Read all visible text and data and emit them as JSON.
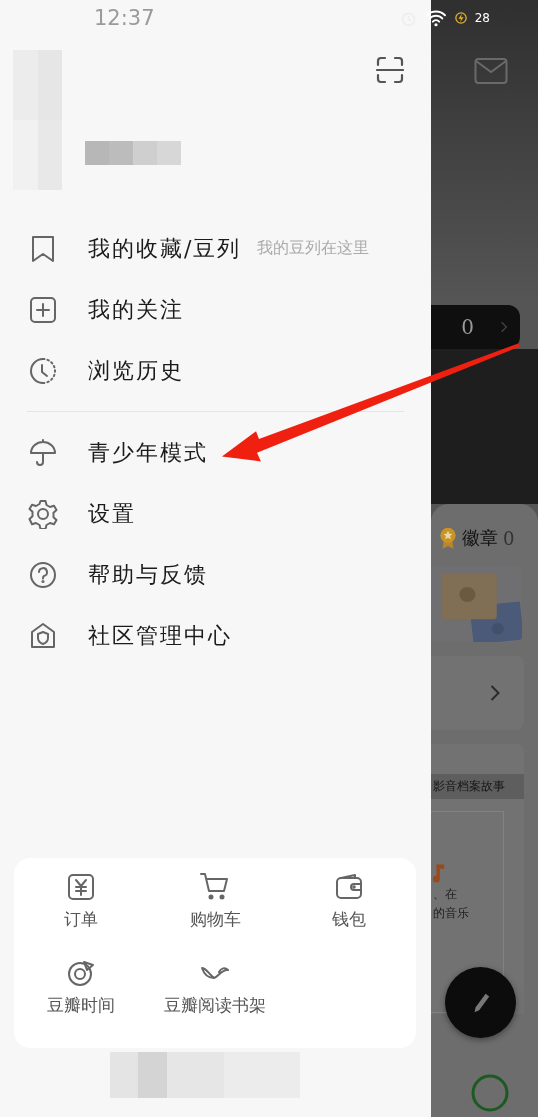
{
  "status_bar": {
    "time": "12:37",
    "battery": "28"
  },
  "drawer": {
    "menu_sections": [
      [
        {
          "kind": "favorites",
          "label": "我的收藏/豆列",
          "hint": "我的豆列在这里"
        },
        {
          "kind": "following",
          "label": "我的关注"
        },
        {
          "kind": "history",
          "label": "浏览历史"
        }
      ],
      [
        {
          "kind": "teen",
          "label": "青少年模式"
        },
        {
          "kind": "settings",
          "label": "设置"
        },
        {
          "kind": "help",
          "label": "帮助与反馈"
        },
        {
          "kind": "community",
          "label": "社区管理中心"
        }
      ]
    ],
    "shortcuts": [
      {
        "kind": "order",
        "label": "订单"
      },
      {
        "kind": "cart",
        "label": "购物车"
      },
      {
        "kind": "wallet",
        "label": "钱包"
      },
      {
        "kind": "time",
        "label": "豆瓣时间"
      },
      {
        "kind": "reading",
        "label": "豆瓣阅读书架"
      }
    ]
  },
  "background_page": {
    "count": "0",
    "badge_label": "徽章",
    "badge_count": "0",
    "card_caption": "影音档案故事",
    "card_text_lines": [
      "、在",
      "的音乐"
    ]
  }
}
